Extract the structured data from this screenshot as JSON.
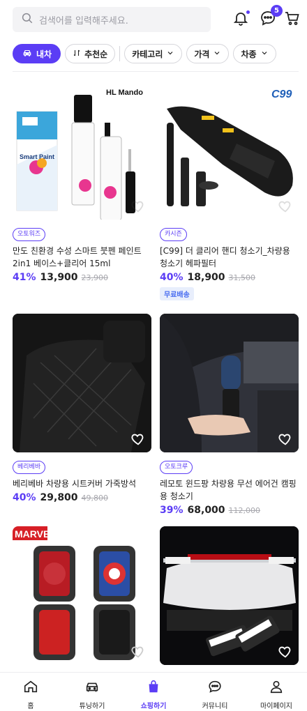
{
  "header": {
    "search_placeholder": "검색어를 입력해주세요.",
    "chat_badge": "5",
    "accent_color": "#5b3df5"
  },
  "filters": {
    "vehicle_label": "내차",
    "sort_label": "추천순",
    "dropdowns": [
      "카테고리",
      "가격",
      "차종"
    ]
  },
  "products": [
    {
      "image_brand": "HL Mando",
      "image_texts": [
        "Smart Paint"
      ],
      "tag": "오토워즈",
      "title": "만도 친환경 수성 스마트 붓펜 페인트 2in1 베이스+클리어 15ml",
      "discount": "41%",
      "price": "13,900",
      "original_price": "23,900",
      "shipping": ""
    },
    {
      "image_brand": "C99",
      "tag": "카시즌",
      "title": "[C99] 더 클리어 핸디 청소기_차량용 청소기 헤파필터",
      "discount": "40%",
      "price": "18,900",
      "original_price": "31,500",
      "shipping": "무료배송"
    },
    {
      "tag": "베리베바",
      "title": "베리베바 차량용 시트커버 가죽방석",
      "discount": "40%",
      "price": "29,800",
      "original_price": "49,800",
      "shipping": ""
    },
    {
      "tag": "오토크루",
      "title": "레모토 윈드팡 차량용 무선 에어건 캠핑용 청소기",
      "discount": "39%",
      "price": "68,000",
      "original_price": "112,000",
      "shipping": ""
    },
    {
      "image_brand": "MARVEL"
    },
    {
      "image_brand": ""
    }
  ],
  "nav": [
    {
      "label": "홈",
      "icon": "home-icon"
    },
    {
      "label": "튜닝하기",
      "icon": "car-icon"
    },
    {
      "label": "쇼핑하기",
      "icon": "shopping-bag-icon",
      "active": true
    },
    {
      "label": "커뮤니티",
      "icon": "community-icon"
    },
    {
      "label": "마이페이지",
      "icon": "user-icon"
    }
  ]
}
